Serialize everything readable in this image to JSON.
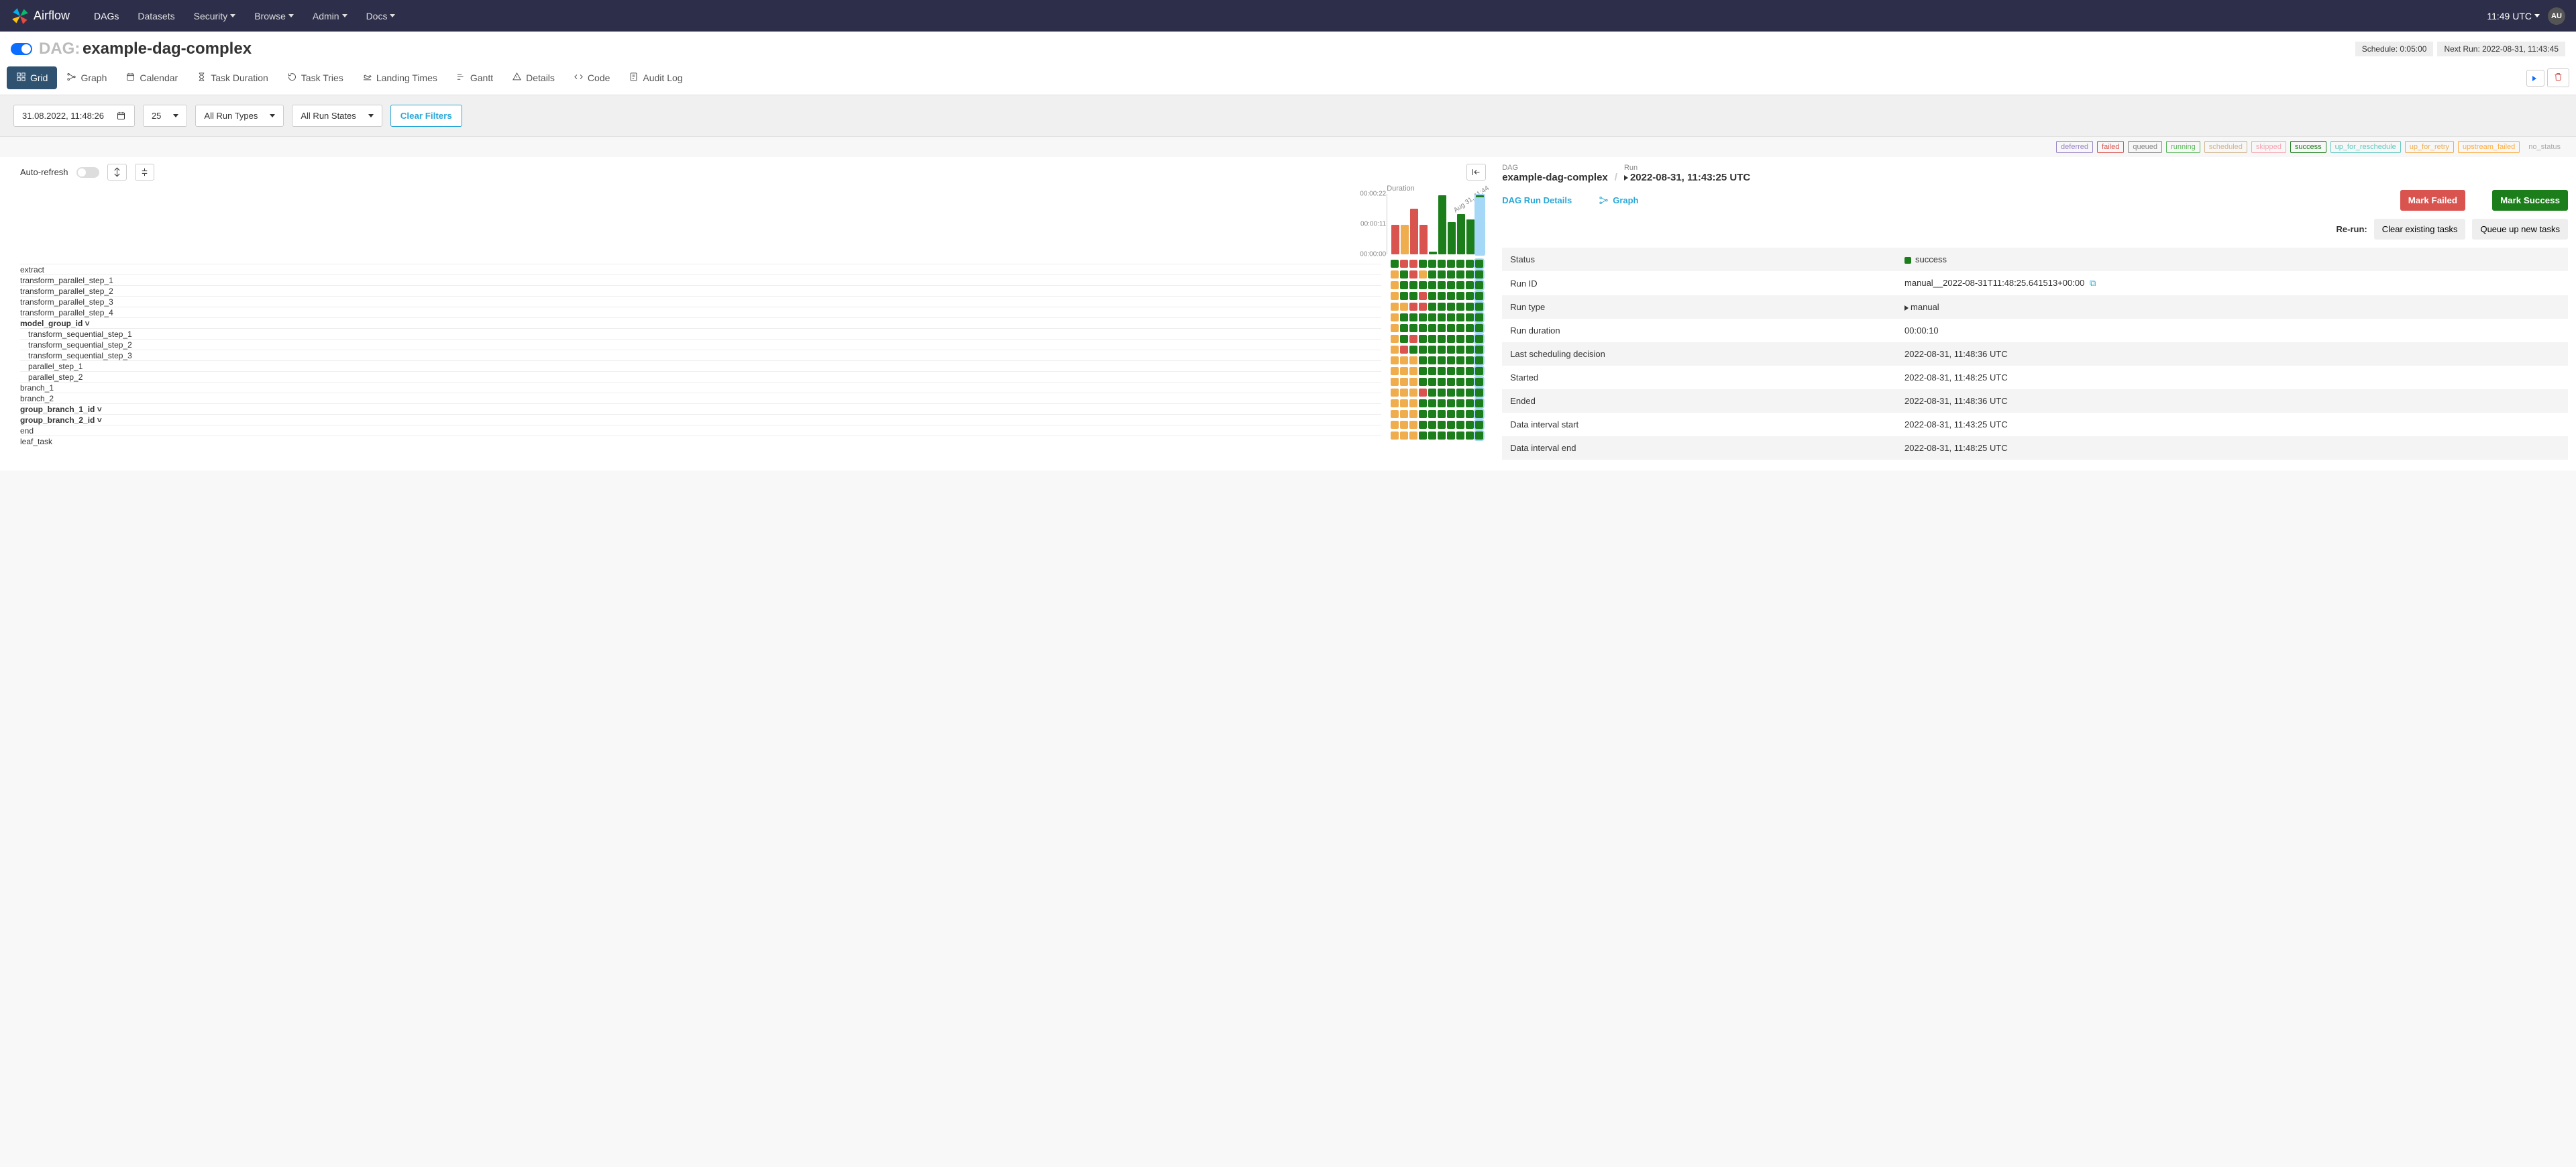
{
  "nav": {
    "brand": "Airflow",
    "items": [
      "DAGs",
      "Datasets",
      "Security",
      "Browse",
      "Admin",
      "Docs"
    ],
    "dropdown_items": [
      "Security",
      "Browse",
      "Admin",
      "Docs"
    ],
    "time": "11:49 UTC",
    "user_initials": "AU"
  },
  "header": {
    "prefix": "DAG:",
    "dag_name": "example-dag-complex",
    "schedule_label": "Schedule: 0:05:00",
    "next_run_label": "Next Run: 2022-08-31, 11:43:45"
  },
  "tabs": [
    {
      "label": "Grid",
      "icon": "grid-icon",
      "active": true
    },
    {
      "label": "Graph",
      "icon": "graph-icon"
    },
    {
      "label": "Calendar",
      "icon": "calendar-icon"
    },
    {
      "label": "Task Duration",
      "icon": "hourglass-icon"
    },
    {
      "label": "Task Tries",
      "icon": "retry-icon"
    },
    {
      "label": "Landing Times",
      "icon": "landing-icon"
    },
    {
      "label": "Gantt",
      "icon": "gantt-icon"
    },
    {
      "label": "Details",
      "icon": "details-icon"
    },
    {
      "label": "Code",
      "icon": "code-icon"
    },
    {
      "label": "Audit Log",
      "icon": "audit-icon"
    }
  ],
  "filters": {
    "date": "31.08.2022, 11:48:26",
    "count": "25",
    "run_types": "All Run Types",
    "run_states": "All Run States",
    "clear_label": "Clear Filters"
  },
  "legend": [
    {
      "label": "deferred",
      "color": "#9985c6"
    },
    {
      "label": "failed",
      "color": "#d9534f"
    },
    {
      "label": "queued",
      "color": "#888"
    },
    {
      "label": "running",
      "color": "#5cb85c"
    },
    {
      "label": "scheduled",
      "color": "#d2b48c"
    },
    {
      "label": "skipped",
      "color": "#f6a6b2"
    },
    {
      "label": "success",
      "color": "#1b7e1b"
    },
    {
      "label": "up_for_reschedule",
      "color": "#5fc9c0"
    },
    {
      "label": "up_for_retry",
      "color": "#f0ad4e"
    },
    {
      "label": "upstream_failed",
      "color": "#ffae42"
    },
    {
      "label": "no_status",
      "color": "#aaa",
      "border": false
    }
  ],
  "left": {
    "auto_refresh_label": "Auto-refresh",
    "selected_run_label": "Aug 31, 11:44"
  },
  "chart_data": {
    "type": "bar",
    "title": "Duration",
    "y_ticks": [
      "00:00:22",
      "00:00:11",
      "00:00:00"
    ],
    "runs": [
      {
        "duration_s": 11,
        "state": "failed"
      },
      {
        "duration_s": 11,
        "state": "up_for_retry"
      },
      {
        "duration_s": 17,
        "state": "failed"
      },
      {
        "duration_s": 11,
        "state": "failed"
      },
      {
        "duration_s": 1,
        "state": "success"
      },
      {
        "duration_s": 22,
        "state": "success"
      },
      {
        "duration_s": 12,
        "state": "success"
      },
      {
        "duration_s": 15,
        "state": "success"
      },
      {
        "duration_s": 13,
        "state": "success"
      },
      {
        "duration_s": 10,
        "state": "running",
        "selected": true
      }
    ],
    "tasks": [
      {
        "name": "extract",
        "indent": 0
      },
      {
        "name": "transform_parallel_step_1",
        "indent": 0
      },
      {
        "name": "transform_parallel_step_2",
        "indent": 0
      },
      {
        "name": "transform_parallel_step_3",
        "indent": 0
      },
      {
        "name": "transform_parallel_step_4",
        "indent": 0
      },
      {
        "name": "model_group_id",
        "indent": 0,
        "group": true
      },
      {
        "name": "transform_sequential_step_1",
        "indent": 1
      },
      {
        "name": "transform_sequential_step_2",
        "indent": 1
      },
      {
        "name": "transform_sequential_step_3",
        "indent": 1
      },
      {
        "name": "parallel_step_1",
        "indent": 1
      },
      {
        "name": "parallel_step_2",
        "indent": 1
      },
      {
        "name": "branch_1",
        "indent": 0
      },
      {
        "name": "branch_2",
        "indent": 0
      },
      {
        "name": "group_branch_1_id",
        "indent": 0,
        "group": true
      },
      {
        "name": "group_branch_2_id",
        "indent": 0,
        "group": true
      },
      {
        "name": "end",
        "indent": 0
      },
      {
        "name": "leaf_task",
        "indent": 0
      }
    ],
    "cell_states": [
      [
        "s",
        "f",
        "f",
        "s",
        "s",
        "s",
        "s",
        "s",
        "s",
        "s"
      ],
      [
        "ufr",
        "s",
        "f",
        "ufr",
        "s",
        "s",
        "s",
        "s",
        "s",
        "s"
      ],
      [
        "ufr",
        "s",
        "s",
        "s",
        "s",
        "s",
        "s",
        "s",
        "s",
        "s"
      ],
      [
        "ufr",
        "s",
        "s",
        "f",
        "s",
        "s",
        "s",
        "s",
        "s",
        "s"
      ],
      [
        "ufr",
        "ufr",
        "f",
        "f",
        "s",
        "s",
        "s",
        "s",
        "s",
        "s"
      ],
      [
        "ufr",
        "s",
        "s",
        "s",
        "s",
        "s",
        "s",
        "s",
        "s",
        "s"
      ],
      [
        "ufr",
        "s",
        "s",
        "s",
        "s",
        "s",
        "s",
        "s",
        "s",
        "s"
      ],
      [
        "ufr",
        "s",
        "f",
        "s",
        "s",
        "s",
        "s",
        "s",
        "s",
        "s"
      ],
      [
        "ufr",
        "f",
        "s",
        "s",
        "s",
        "s",
        "s",
        "s",
        "s",
        "s"
      ],
      [
        "ufr",
        "ufr",
        "ufr",
        "s",
        "s",
        "s",
        "s",
        "s",
        "s",
        "s"
      ],
      [
        "ufr",
        "ufr",
        "ufr",
        "s",
        "s",
        "s",
        "s",
        "s",
        "s",
        "s"
      ],
      [
        "ufr",
        "ufr",
        "ufr",
        "s",
        "s",
        "s",
        "s",
        "s",
        "s",
        "s"
      ],
      [
        "ufr",
        "ufr",
        "ufr",
        "f",
        "s",
        "s",
        "s",
        "s",
        "s",
        "s"
      ],
      [
        "ufr",
        "ufr",
        "ufr",
        "s",
        "s",
        "s",
        "s",
        "s",
        "s",
        "s"
      ],
      [
        "ufr",
        "ufr",
        "ufr",
        "s",
        "s",
        "s",
        "s",
        "s",
        "s",
        "s"
      ],
      [
        "ufr",
        "ufr",
        "ufr",
        "s",
        "s",
        "s",
        "s",
        "s",
        "s",
        "s"
      ],
      [
        "ufr",
        "ufr",
        "ufr",
        "s",
        "s",
        "s",
        "s",
        "s",
        "s",
        "s"
      ]
    ]
  },
  "right": {
    "bc_dag_label": "DAG",
    "bc_dag_value": "example-dag-complex",
    "bc_run_label": "Run",
    "bc_run_value": "2022-08-31, 11:43:25 UTC",
    "tabs": {
      "details": "DAG Run Details",
      "graph": "Graph"
    },
    "mark_failed": "Mark Failed",
    "mark_success": "Mark Success",
    "rerun_label": "Re-run:",
    "clear_existing": "Clear existing tasks",
    "queue_new": "Queue up new tasks",
    "rows": [
      {
        "k": "Status",
        "v": "success",
        "status": true
      },
      {
        "k": "Run ID",
        "v": "manual__2022-08-31T11:48:25.641513+00:00",
        "copy": true
      },
      {
        "k": "Run type",
        "v": "manual",
        "play": true
      },
      {
        "k": "Run duration",
        "v": "00:00:10"
      },
      {
        "k": "Last scheduling decision",
        "v": "2022-08-31, 11:48:36 UTC"
      },
      {
        "k": "Started",
        "v": "2022-08-31, 11:48:25 UTC"
      },
      {
        "k": "Ended",
        "v": "2022-08-31, 11:48:36 UTC"
      },
      {
        "k": "Data interval start",
        "v": "2022-08-31, 11:43:25 UTC"
      },
      {
        "k": "Data interval end",
        "v": "2022-08-31, 11:48:25 UTC"
      }
    ]
  }
}
